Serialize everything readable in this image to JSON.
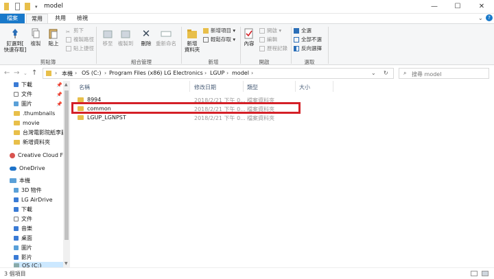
{
  "window": {
    "title": "model",
    "controls": {
      "minimize": "—",
      "maximize": "☐",
      "close": "✕"
    }
  },
  "ribbon": {
    "tabs": [
      "檔案",
      "常用",
      "共用",
      "檢視"
    ],
    "clipboard": {
      "pin_label_1": "釘選到[",
      "pin_label_2": "快速存取]",
      "copy": "複製",
      "paste": "貼上",
      "cut": "剪下",
      "copy_path": "複製路徑",
      "paste_shortcut": "貼上捷徑",
      "group": "剪貼簿"
    },
    "organize": {
      "move_to": "移至",
      "copy_to": "複製到",
      "delete": "刪除",
      "rename": "重新命名",
      "group": "組合管理"
    },
    "new": {
      "new_folder_1": "新增",
      "new_folder_2": "資料夾",
      "new_item": "新增項目 ▾",
      "easy_access": "輕鬆存取 ▾",
      "group": "新增"
    },
    "open": {
      "properties": "內容",
      "open": "開啟 ▾",
      "edit": "編輯",
      "history": "歷程記錄",
      "group": "開啟"
    },
    "select": {
      "select_all": "全選",
      "select_none": "全部不選",
      "invert": "反向選擇",
      "group": "選取"
    }
  },
  "address": {
    "path": [
      "本機",
      "OS (C:)",
      "Program Files (x86)",
      "LG Electronics",
      "LGUP",
      "model"
    ],
    "search_placeholder": "搜尋 model"
  },
  "nav": {
    "items": [
      {
        "label": "下載",
        "pinned": true
      },
      {
        "label": "文件",
        "pinned": true
      },
      {
        "label": "圖片",
        "pinned": true
      },
      {
        "label": ".thumbnails",
        "pinned": false
      },
      {
        "label": "movie",
        "pinned": false
      },
      {
        "label": "台灣電影院紙李麗",
        "pinned": false
      },
      {
        "label": "新增資料夾",
        "pinned": false
      },
      {
        "label": "Creative Cloud Files",
        "pinned": false
      },
      {
        "label": "OneDrive",
        "pinned": false
      },
      {
        "label": "本機",
        "pinned": false
      },
      {
        "label": "3D 物件",
        "pinned": false
      },
      {
        "label": "LG AirDrive",
        "pinned": false
      },
      {
        "label": "下載",
        "pinned": false
      },
      {
        "label": "文件",
        "pinned": false
      },
      {
        "label": "音樂",
        "pinned": false
      },
      {
        "label": "桌面",
        "pinned": false
      },
      {
        "label": "圖片",
        "pinned": false
      },
      {
        "label": "影片",
        "pinned": false
      },
      {
        "label": "OS (C:)",
        "pinned": false
      }
    ]
  },
  "list": {
    "columns": {
      "name": "名稱",
      "date": "修改日期",
      "type": "類型",
      "size": "大小"
    },
    "rows": [
      {
        "name": "8994",
        "date": "2018/2/21 下午 0...",
        "type": "檔案資料夾"
      },
      {
        "name": "common",
        "date": "2018/2/21 下午 0...",
        "type": "檔案資料夾"
      },
      {
        "name": "LGUP_LGNPST",
        "date": "2018/2/21 下午 0...",
        "type": "檔案資料夾"
      }
    ]
  },
  "status": {
    "count": "3 個項目"
  },
  "colors": {
    "accent": "#1979ca",
    "highlight": "#d42027",
    "folder": "#e8bf4a"
  }
}
